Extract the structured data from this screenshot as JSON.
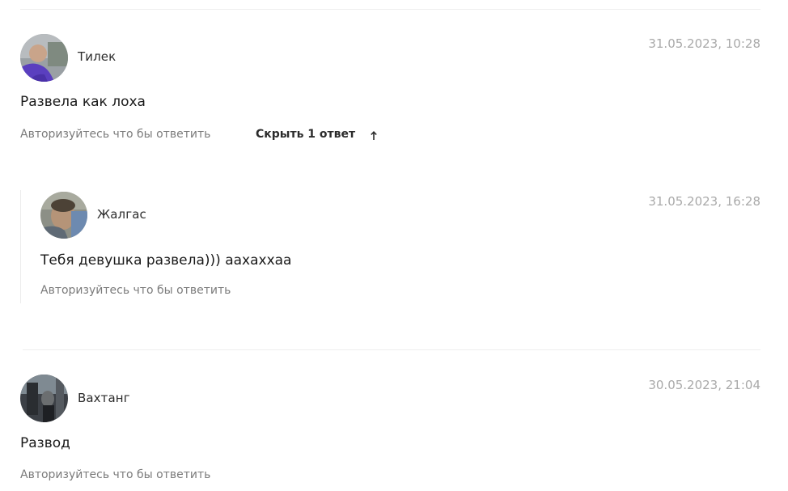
{
  "comments": [
    {
      "author": "Тилек",
      "date": "31.05.2023, 10:28",
      "text": "Развела как лоха",
      "reply_action": "Авторизуйтесь что бы ответить",
      "toggle_label": "Скрыть 1 ответ",
      "toggle_icon": "arrow-up-icon",
      "replies": [
        {
          "author": "Жалгас",
          "date": "31.05.2023, 16:28",
          "text": "Тебя девушка развела))) аахаххаа",
          "reply_action": "Авторизуйтесь что бы ответить"
        }
      ]
    },
    {
      "author": "Вахтанг",
      "date": "30.05.2023, 21:04",
      "text": "Развод",
      "reply_action": "Авторизуйтесь что бы ответить",
      "replies": []
    }
  ],
  "colors": {
    "date": "#a9a9a9",
    "reply_link": "#7b7b7b",
    "divider": "#eeeeee"
  }
}
